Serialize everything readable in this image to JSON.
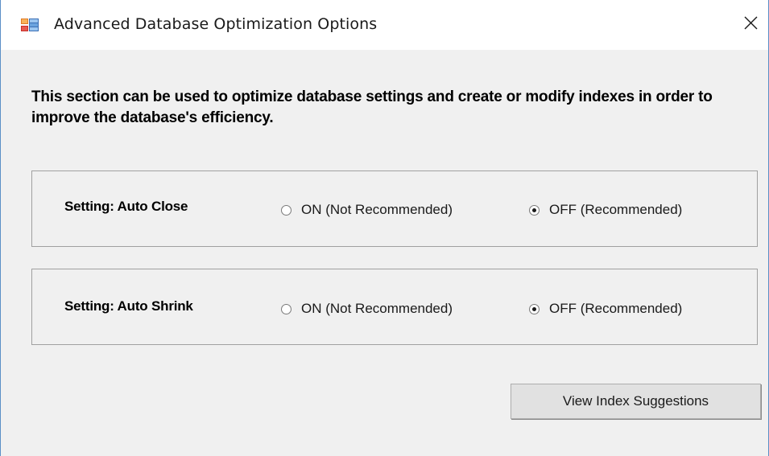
{
  "window": {
    "title": "Advanced Database Optimization Options",
    "icon": "database-app-icon",
    "close_icon": "close-icon"
  },
  "intro_text": "This section can be used to optimize database settings and create or modify indexes in order to improve the database's efficiency.",
  "settings": [
    {
      "label": "Setting: Auto Close",
      "options": [
        {
          "label": "ON (Not Recommended)",
          "checked": false
        },
        {
          "label": "OFF (Recommended)",
          "checked": true
        }
      ]
    },
    {
      "label": "Setting: Auto Shrink",
      "options": [
        {
          "label": "ON (Not Recommended)",
          "checked": false
        },
        {
          "label": "OFF (Recommended)",
          "checked": true
        }
      ]
    }
  ],
  "buttons": {
    "view_index_suggestions": "View Index Suggestions"
  },
  "colors": {
    "window_bg": "#f0f0f0",
    "titlebar_bg": "#ffffff",
    "border_accent": "#5b8fc7",
    "button_bg": "#e1e1e1"
  }
}
